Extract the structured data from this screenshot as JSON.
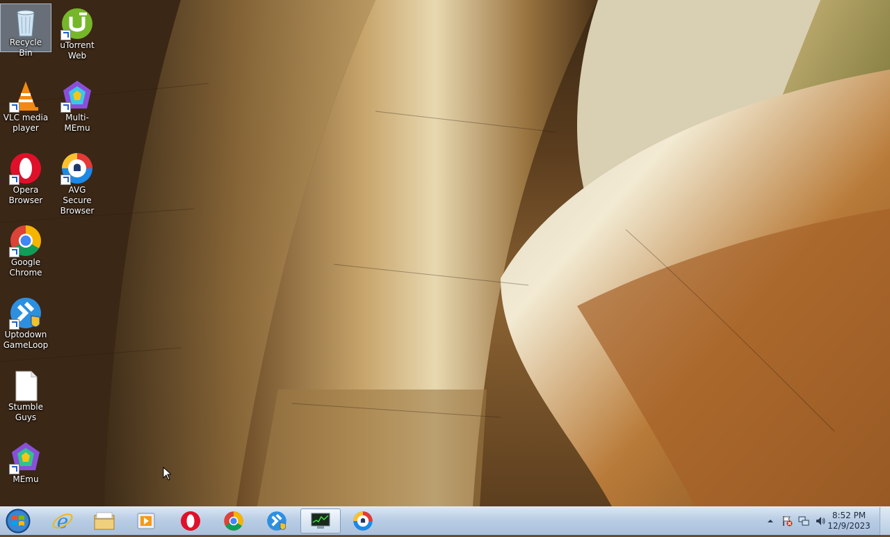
{
  "desktop": {
    "icons": [
      {
        "label": "Recycle Bin",
        "icon": "recycle-bin-icon"
      },
      {
        "label": "uTorrent Web",
        "icon": "utorrent-icon"
      },
      {
        "label": "VLC media player",
        "icon": "vlc-icon"
      },
      {
        "label": "Multi-MEmu",
        "icon": "multi-memu-icon"
      },
      {
        "label": "Opera Browser",
        "icon": "opera-icon"
      },
      {
        "label": "AVG Secure Browser",
        "icon": "avg-browser-icon"
      },
      {
        "label": "Google Chrome",
        "icon": "chrome-icon"
      },
      {
        "label": "Uptodown GameLoop",
        "icon": "gameloop-icon"
      },
      {
        "label": "Stumble Guys",
        "icon": "blank-file-icon"
      },
      {
        "label": "MEmu",
        "icon": "memu-icon"
      }
    ]
  },
  "taskbar": {
    "pinned": [
      {
        "name": "Internet Explorer",
        "icon": "internet-explorer-icon"
      },
      {
        "name": "Windows Explorer",
        "icon": "file-explorer-icon"
      },
      {
        "name": "Windows Media Player",
        "icon": "media-player-icon"
      },
      {
        "name": "Opera",
        "icon": "opera-icon"
      },
      {
        "name": "Google Chrome",
        "icon": "chrome-icon"
      },
      {
        "name": "GameLoop",
        "icon": "gameloop-icon"
      },
      {
        "name": "Task Manager",
        "icon": "task-manager-icon"
      },
      {
        "name": "AVG Secure Browser",
        "icon": "avg-browser-icon"
      }
    ],
    "clock": {
      "time": "8:52 PM",
      "date": "12/9/2023"
    }
  },
  "colors": {
    "taskbar": "#b9cde4",
    "accent": "#1a5fd0"
  }
}
